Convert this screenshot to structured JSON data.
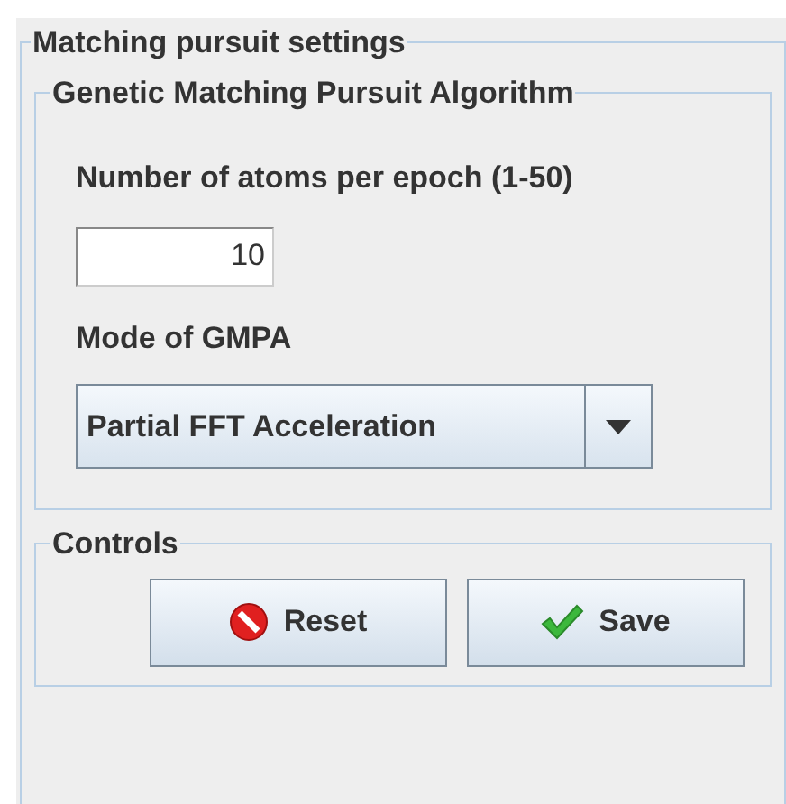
{
  "settings_panel": {
    "title": "Matching pursuit settings"
  },
  "algorithm_group": {
    "title": "Genetic Matching Pursuit Algorithm",
    "atoms_label": "Number of atoms per epoch (1-50)",
    "atoms_value": "10",
    "mode_label": "Mode of GMPA",
    "mode_value": "Partial FFT Acceleration"
  },
  "controls_group": {
    "title": "Controls",
    "buttons": [
      {
        "label": "Reset",
        "kind": "reset"
      },
      {
        "label": "Save",
        "kind": "save"
      }
    ]
  }
}
